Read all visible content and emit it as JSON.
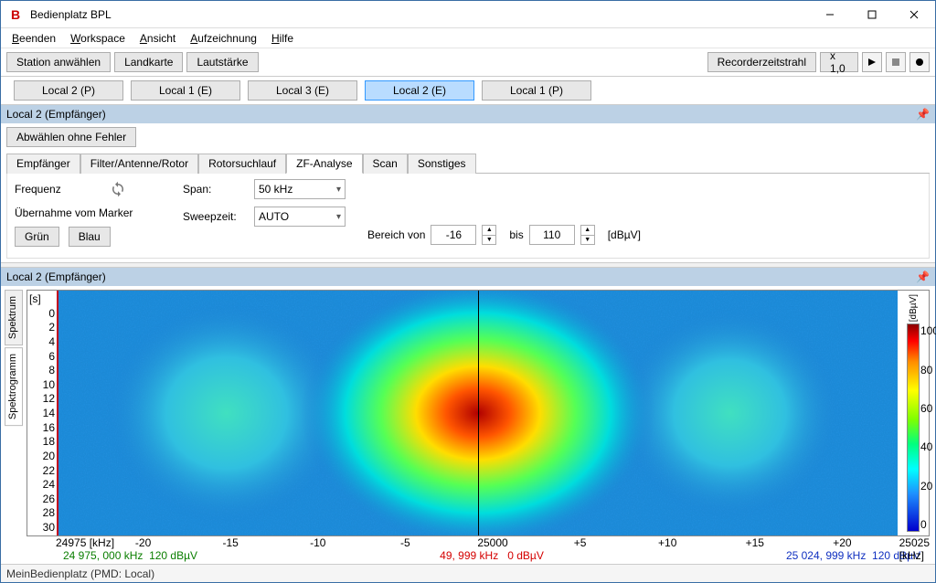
{
  "window": {
    "title": "Bedienplatz BPL"
  },
  "menu": {
    "items": [
      "Beenden",
      "Workspace",
      "Ansicht",
      "Aufzeichnung",
      "Hilfe"
    ]
  },
  "toolbar1": {
    "station": "Station anwählen",
    "map": "Landkarte",
    "volume": "Lautstärke",
    "recorder": "Recorderzeitstrahl",
    "speed": "x 1,0"
  },
  "locations": {
    "items": [
      "Local 2 (P)",
      "Local 1 (E)",
      "Local 3 (E)",
      "Local 2 (E)",
      "Local 1 (P)"
    ],
    "active_index": 3
  },
  "section1": {
    "title": "Local 2 (Empfänger)"
  },
  "receiver": {
    "deselect": "Abwählen ohne Fehler",
    "tabs": [
      "Empfänger",
      "Filter/Antenne/Rotor",
      "Rotorsuchlauf",
      "ZF-Analyse",
      "Scan",
      "Sonstiges"
    ],
    "active_tab": 3,
    "freq_label": "Frequenz",
    "marker_label": "Übernahme vom Marker",
    "green": "Grün",
    "blue": "Blau",
    "span_label": "Span:",
    "span_value": "50 kHz",
    "sweep_label": "Sweepzeit:",
    "sweep_value": "AUTO",
    "range_from": "Bereich von",
    "range_from_val": "-16",
    "range_to": "bis",
    "range_to_val": "110",
    "range_unit": "[dBµV]"
  },
  "section2": {
    "title": "Local 2 (Empfänger)"
  },
  "sidetabs": {
    "spectrum": "Spektrum",
    "spectrogram": "Spektrogramm"
  },
  "chart_data": {
    "type": "heatmap",
    "title": "",
    "xlabel_left": "24975 [kHz]",
    "xlabel_center": "25000",
    "xlabel_right": "25025 [kHz]",
    "x_ticks": [
      "-20",
      "-15",
      "-10",
      "-5",
      "",
      "+5",
      "+10",
      "+15",
      "+20"
    ],
    "ylabel": "[s]",
    "y_ticks": [
      0,
      2,
      4,
      6,
      8,
      10,
      12,
      14,
      16,
      18,
      20,
      22,
      24,
      26,
      28,
      30
    ],
    "colorbar_label": "[dBµV]",
    "colorbar_ticks": [
      100,
      80,
      60,
      40,
      20,
      0
    ],
    "signals": [
      {
        "center_rel": -0.3,
        "peak_dbuv": 45,
        "radius_rel": 0.12
      },
      {
        "center_rel": 0.0,
        "peak_dbuv": 105,
        "radius_rel": 0.18
      },
      {
        "center_rel": 0.3,
        "peak_dbuv": 40,
        "radius_rel": 0.11
      }
    ],
    "background_dbuv": 10
  },
  "readouts": {
    "left_freq": "24 975, 000 kHz",
    "left_level": "120 dBµV",
    "mid_freq": "49, 999 kHz",
    "mid_level": "0 dBµV",
    "right_freq": "25 024, 999 kHz",
    "right_level": "120 dBµV"
  },
  "status": {
    "text": "MeinBedienplatz (PMD: Local)"
  }
}
